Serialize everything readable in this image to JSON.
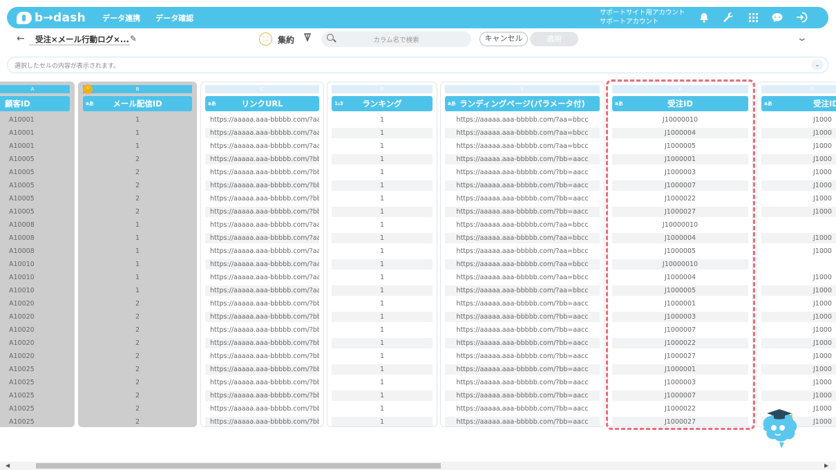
{
  "app": {
    "logo_text": "b→dash",
    "nav": [
      "データ連携",
      "データ確認"
    ],
    "support_line1": "サポートサイト用アカウント",
    "support_line2": "サポートアカウント",
    "icons": [
      "bell-icon",
      "wrench-icon",
      "grid-icon",
      "chat-icon",
      "logout-icon"
    ]
  },
  "toolbar": {
    "back_symbol": "←",
    "sheet_title": "受注×メール行動ログ×...",
    "aggregate_label": "集約",
    "search_placeholder": "カラム名で検索",
    "cancel_label": "キャンセル",
    "apply_label": "適用"
  },
  "cellbar": {
    "text": "選択したセルの内容が表示されます。",
    "chev": "⌄"
  },
  "columns": [
    {
      "letter": "A",
      "header": "顧客ID",
      "type": "",
      "align": "left"
    },
    {
      "letter": "B",
      "header": "メール配信ID",
      "type": "aあ",
      "align": "center",
      "key": true
    },
    {
      "letter": "C",
      "header": "リンクURL",
      "type": "aあ",
      "align": "left"
    },
    {
      "letter": "D",
      "header": "ランキング",
      "type": "1₂3",
      "align": "center"
    },
    {
      "letter": "E",
      "header": "ランディングページ(パラメータ付)",
      "type": "aあ",
      "align": "center"
    },
    {
      "letter": "F",
      "header": "受注ID",
      "type": "aあ",
      "align": "center"
    },
    {
      "letter": "G",
      "header": "受注ID",
      "type": "aあ",
      "align": "left"
    }
  ],
  "rows": {
    "customer_id": [
      "A10001",
      "A10001",
      "A10001",
      "A10005",
      "A10005",
      "A10005",
      "A10005",
      "A10005",
      "A10008",
      "A10008",
      "A10008",
      "A10010",
      "A10010",
      "A10010",
      "A10020",
      "A10020",
      "A10020",
      "A10020",
      "A10020",
      "A10025",
      "A10025",
      "A10025",
      "A10025",
      "A10025"
    ],
    "mail_id": [
      "1",
      "1",
      "1",
      "2",
      "2",
      "2",
      "2",
      "2",
      "1",
      "1",
      "1",
      "1",
      "1",
      "1",
      "2",
      "2",
      "2",
      "2",
      "2",
      "2",
      "2",
      "2",
      "2",
      "2"
    ],
    "link_url": [
      "https://aaaaa.aaa-bbbbb.com/?aa...",
      "https://aaaaa.aaa-bbbbb.com/?aa...",
      "https://aaaaa.aaa-bbbbb.com/?aa...",
      "https://aaaaa.aaa-bbbbb.com/?bb...",
      "https://aaaaa.aaa-bbbbb.com/?bb...",
      "https://aaaaa.aaa-bbbbb.com/?bb...",
      "https://aaaaa.aaa-bbbbb.com/?bb...",
      "https://aaaaa.aaa-bbbbb.com/?bb...",
      "https://aaaaa.aaa-bbbbb.com/?aa...",
      "https://aaaaa.aaa-bbbbb.com/?aa...",
      "https://aaaaa.aaa-bbbbb.com/?aa...",
      "https://aaaaa.aaa-bbbbb.com/?aa...",
      "https://aaaaa.aaa-bbbbb.com/?aa...",
      "https://aaaaa.aaa-bbbbb.com/?aa...",
      "https://aaaaa.aaa-bbbbb.com/?bb...",
      "https://aaaaa.aaa-bbbbb.com/?bb...",
      "https://aaaaa.aaa-bbbbb.com/?bb...",
      "https://aaaaa.aaa-bbbbb.com/?bb...",
      "https://aaaaa.aaa-bbbbb.com/?bb...",
      "https://aaaaa.aaa-bbbbb.com/?bb...",
      "https://aaaaa.aaa-bbbbb.com/?bb...",
      "https://aaaaa.aaa-bbbbb.com/?bb...",
      "https://aaaaa.aaa-bbbbb.com/?bb...",
      "https://aaaaa.aaa-bbbbb.com/?bb..."
    ],
    "ranking": [
      "1",
      "1",
      "1",
      "1",
      "1",
      "1",
      "1",
      "1",
      "1",
      "1",
      "1",
      "1",
      "1",
      "1",
      "1",
      "1",
      "1",
      "1",
      "1",
      "1",
      "1",
      "1",
      "1",
      "1"
    ],
    "landing": [
      "https://aaaaa.aaa-bbbbb.com/?aa=bbcc",
      "https://aaaaa.aaa-bbbbb.com/?aa=bbcc",
      "https://aaaaa.aaa-bbbbb.com/?aa=bbcc",
      "https://aaaaa.aaa-bbbbb.com/?bb=aacc",
      "https://aaaaa.aaa-bbbbb.com/?bb=aacc",
      "https://aaaaa.aaa-bbbbb.com/?bb=aacc",
      "https://aaaaa.aaa-bbbbb.com/?bb=aacc",
      "https://aaaaa.aaa-bbbbb.com/?bb=aacc",
      "https://aaaaa.aaa-bbbbb.com/?aa=bbcc",
      "https://aaaaa.aaa-bbbbb.com/?aa=bbcc",
      "https://aaaaa.aaa-bbbbb.com/?aa=bbcc",
      "https://aaaaa.aaa-bbbbb.com/?aa=bbcc",
      "https://aaaaa.aaa-bbbbb.com/?aa=bbcc",
      "https://aaaaa.aaa-bbbbb.com/?aa=bbcc",
      "https://aaaaa.aaa-bbbbb.com/?bb=aacc",
      "https://aaaaa.aaa-bbbbb.com/?bb=aacc",
      "https://aaaaa.aaa-bbbbb.com/?bb=aacc",
      "https://aaaaa.aaa-bbbbb.com/?bb=aacc",
      "https://aaaaa.aaa-bbbbb.com/?bb=aacc",
      "https://aaaaa.aaa-bbbbb.com/?bb=aacc",
      "https://aaaaa.aaa-bbbbb.com/?bb=aacc",
      "https://aaaaa.aaa-bbbbb.com/?bb=aacc",
      "https://aaaaa.aaa-bbbbb.com/?bb=aacc",
      "https://aaaaa.aaa-bbbbb.com/?bb=aacc"
    ],
    "order_id": [
      "J10000010",
      "J1000004",
      "J1000005",
      "J1000001",
      "J1000003",
      "J1000007",
      "J1000022",
      "J1000027",
      "J10000010",
      "J1000004",
      "J1000005",
      "J10000010",
      "J1000004",
      "J1000005",
      "J1000001",
      "J1000003",
      "J1000007",
      "J1000022",
      "J1000027",
      "J1000001",
      "J1000003",
      "J1000007",
      "J1000022",
      "J1000027"
    ],
    "order_id2": [
      "J1000",
      "J1000",
      "J1000",
      "J1000",
      "J1000",
      "J1000",
      "J1000",
      "J1000",
      "",
      "J1000",
      "J1000",
      "",
      "J1000",
      "J1000",
      "J1000",
      "J1000",
      "J1000",
      "J1000",
      "J1000",
      "J1000",
      "J1000",
      "J1000",
      "J1000",
      "J1000"
    ]
  },
  "colors": {
    "accent": "#4ec3ea",
    "highlight_frame": "#ea6d7a",
    "key_icon": "#f3b01d"
  },
  "scrollbar": {
    "left_arrow": "◀",
    "right_arrow": "▶"
  }
}
